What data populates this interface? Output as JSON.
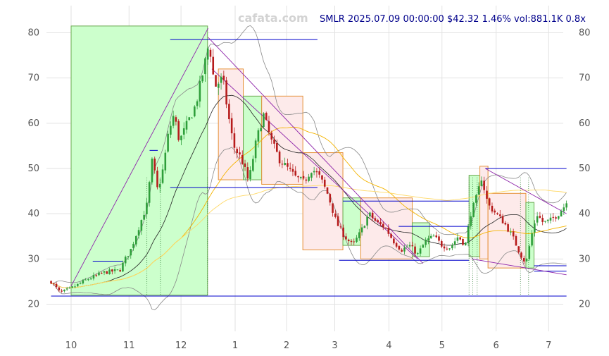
{
  "header": {
    "watermark": "cafata.com",
    "info": "SMLR 2025.07.09 00:00:00 $42.32 1.46% vol:881.1K 0.8x"
  },
  "chart_data": {
    "type": "candlestick",
    "ticker": "SMLR",
    "ylim": [
      14,
      86
    ],
    "y_ticks": [
      20,
      30,
      40,
      50,
      60,
      70,
      80
    ],
    "x_ticks": [
      {
        "label": "10",
        "m": 0
      },
      {
        "label": "11",
        "m": 1.07
      },
      {
        "label": "12",
        "m": 2.03
      },
      {
        "label": "1",
        "m": 3.03
      },
      {
        "label": "2",
        "m": 3.98
      },
      {
        "label": "3",
        "m": 4.87
      },
      {
        "label": "4",
        "m": 5.87
      },
      {
        "label": "5",
        "m": 6.85
      },
      {
        "label": "6",
        "m": 7.85
      },
      {
        "label": "7",
        "m": 8.82
      }
    ],
    "price_keypoints": [
      [
        -0.37,
        25.0
      ],
      [
        -0.2,
        22.5
      ],
      [
        0.0,
        23.5
      ],
      [
        0.3,
        25.5
      ],
      [
        0.6,
        27.0
      ],
      [
        0.9,
        27.5
      ],
      [
        1.0,
        30.0
      ],
      [
        1.1,
        32.0
      ],
      [
        1.25,
        37.0
      ],
      [
        1.4,
        42.0
      ],
      [
        1.5,
        52.0
      ],
      [
        1.6,
        45.0
      ],
      [
        1.7,
        50.0
      ],
      [
        1.8,
        58.0
      ],
      [
        1.9,
        62.0
      ],
      [
        2.0,
        56.0
      ],
      [
        2.15,
        60.0
      ],
      [
        2.3,
        64.0
      ],
      [
        2.45,
        72.0
      ],
      [
        2.55,
        78.0
      ],
      [
        2.65,
        68.0
      ],
      [
        2.8,
        70.0
      ],
      [
        2.9,
        62.0
      ],
      [
        3.0,
        55.0
      ],
      [
        3.15,
        52.0
      ],
      [
        3.28,
        47.0
      ],
      [
        3.4,
        55.0
      ],
      [
        3.55,
        62.0
      ],
      [
        3.7,
        56.0
      ],
      [
        3.85,
        52.0
      ],
      [
        4.0,
        50.0
      ],
      [
        4.15,
        48.0
      ],
      [
        4.3,
        47.0
      ],
      [
        4.45,
        50.0
      ],
      [
        4.6,
        48.0
      ],
      [
        4.75,
        44.0
      ],
      [
        4.9,
        38.0
      ],
      [
        5.05,
        35.0
      ],
      [
        5.2,
        33.0
      ],
      [
        5.35,
        36.0
      ],
      [
        5.5,
        40.0
      ],
      [
        5.65,
        38.0
      ],
      [
        5.8,
        37.0
      ],
      [
        5.95,
        34.0
      ],
      [
        6.1,
        32.0
      ],
      [
        6.25,
        33.0
      ],
      [
        6.4,
        31.0
      ],
      [
        6.55,
        34.0
      ],
      [
        6.7,
        35.0
      ],
      [
        6.85,
        33.0
      ],
      [
        7.0,
        32.5
      ],
      [
        7.15,
        35.0
      ],
      [
        7.28,
        33.0
      ],
      [
        7.38,
        40.0
      ],
      [
        7.5,
        44.0
      ],
      [
        7.58,
        48.0
      ],
      [
        7.7,
        42.0
      ],
      [
        7.85,
        40.0
      ],
      [
        8.0,
        38.0
      ],
      [
        8.15,
        35.0
      ],
      [
        8.3,
        31.0
      ],
      [
        8.4,
        29.0
      ],
      [
        8.5,
        35.0
      ],
      [
        8.6,
        40.0
      ],
      [
        8.72,
        38.0
      ],
      [
        8.85,
        38.5
      ],
      [
        9.0,
        40.0
      ],
      [
        9.15,
        42.3
      ]
    ],
    "zones": [
      {
        "x0": 0,
        "x1": 2.52,
        "y0": 22.0,
        "y1": 81.5,
        "dir": "up"
      },
      {
        "x0": 2.72,
        "x1": 3.18,
        "y0": 47.5,
        "y1": 72.0,
        "dir": "down"
      },
      {
        "x0": 3.18,
        "x1": 3.52,
        "y0": 47.5,
        "y1": 66.0,
        "dir": "up"
      },
      {
        "x0": 3.52,
        "x1": 4.28,
        "y0": 46.5,
        "y1": 66.0,
        "dir": "down"
      },
      {
        "x0": 4.28,
        "x1": 5.02,
        "y0": 32.0,
        "y1": 53.5,
        "dir": "down"
      },
      {
        "x0": 5.02,
        "x1": 5.35,
        "y0": 33.0,
        "y1": 43.5,
        "dir": "up"
      },
      {
        "x0": 5.35,
        "x1": 6.3,
        "y0": 30.0,
        "y1": 43.5,
        "dir": "down"
      },
      {
        "x0": 6.3,
        "x1": 6.62,
        "y0": 30.5,
        "y1": 38.0,
        "dir": "up"
      },
      {
        "x0": 7.35,
        "x1": 7.55,
        "y0": 30.5,
        "y1": 48.5,
        "dir": "up"
      },
      {
        "x0": 7.55,
        "x1": 7.7,
        "y0": 30.0,
        "y1": 50.5,
        "dir": "down"
      },
      {
        "x0": 7.7,
        "x1": 8.4,
        "y0": 28.0,
        "y1": 44.5,
        "dir": "down"
      },
      {
        "x0": 8.4,
        "x1": 8.55,
        "y0": 28.0,
        "y1": 42.5,
        "dir": "up"
      }
    ],
    "hlines": [
      {
        "x0": -0.37,
        "x1": 9.15,
        "y": 21.8,
        "color": "#0000cc"
      },
      {
        "x0": 1.83,
        "x1": 4.55,
        "y": 78.5,
        "color": "#0000cc"
      },
      {
        "x0": 1.83,
        "x1": 4.55,
        "y": 45.8,
        "color": "#0000cc"
      },
      {
        "x0": 1.45,
        "x1": 1.6,
        "y": 54.0,
        "color": "#0000cc"
      },
      {
        "x0": 0.4,
        "x1": 0.95,
        "y": 29.5,
        "color": "#0000cc"
      },
      {
        "x0": 5.02,
        "x1": 7.35,
        "y": 42.8,
        "color": "#0000cc"
      },
      {
        "x0": 4.95,
        "x1": 7.35,
        "y": 29.7,
        "color": "#0000cc"
      },
      {
        "x0": 6.05,
        "x1": 7.35,
        "y": 37.2,
        "color": "#0000cc"
      },
      {
        "x0": 7.65,
        "x1": 9.15,
        "y": 50.0,
        "color": "#0000cc"
      },
      {
        "x0": 8.55,
        "x1": 9.15,
        "y": 28.5,
        "color": "#0000cc"
      },
      {
        "x0": 8.55,
        "x1": 9.15,
        "y": 27.3,
        "color": "#0000cc"
      }
    ],
    "trendlines": [
      {
        "x0": 0.0,
        "y0": 24.0,
        "x1": 2.53,
        "y1": 81.0
      },
      {
        "x0": 2.53,
        "y0": 79.0,
        "x1": 6.5,
        "y1": 29.0
      },
      {
        "x0": 2.6,
        "y0": 72.0,
        "x1": 6.4,
        "y1": 30.0
      },
      {
        "x0": 7.65,
        "y0": 50.0,
        "x1": 9.15,
        "y1": 40.0
      },
      {
        "x0": 7.4,
        "y0": 30.0,
        "x1": 9.15,
        "y1": 26.5
      }
    ],
    "vmarkers": [
      1.4,
      1.65,
      2.52,
      7.35,
      7.42,
      7.5,
      8.3,
      8.45
    ]
  }
}
